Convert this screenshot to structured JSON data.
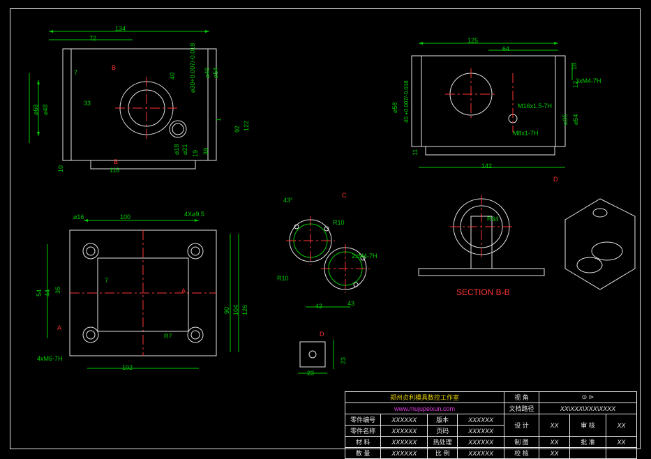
{
  "dims": {
    "d134": "134",
    "d72": "72",
    "d7a": "7",
    "d40": "40",
    "dB": "B",
    "d33": "33",
    "d68": "⌀68",
    "d48": "⌀48",
    "d1": "1",
    "d116": "116",
    "d10": "10",
    "d19": "19",
    "d39": "39",
    "d92": "92",
    "d122": "122",
    "d46": "⌀46",
    "d54": "⌀54",
    "d18": "⌀18",
    "d21": "⌀21",
    "d125": "125",
    "d64": "64",
    "d18a": "18",
    "d12": "12",
    "d3m4": "3xM4-7H",
    "d58": "⌀58",
    "dtol": "40 +0.007/-0.018",
    "dm16": "M16x1.5-7H",
    "dm8": "M8x1-7H",
    "d35": "⌀35",
    "d54b": "⌀54",
    "d11": "11",
    "d142": "142",
    "dD": "D",
    "d35b": "⌀35",
    "d16": "⌀16",
    "d100": "100",
    "d4x95": "4X⌀9.5",
    "d44": "44",
    "d54c": "54",
    "d35c": "35",
    "d7b": "7",
    "dA": "A",
    "d90": "90",
    "d104": "104",
    "d126": "126",
    "dr7": "R7",
    "d102": "102",
    "d4m6": "4xM6-7H",
    "d43": "43°",
    "dC": "C",
    "dr10": "R10",
    "d2m4": "2xM4-7H",
    "dr10b": "R10",
    "d42": "42",
    "d43b": "43",
    "dD2": "D",
    "d23": "23",
    "d23b": "23",
    "dr34": "R34",
    "secbb": "SECTION B-B",
    "d30007": "⌀30+0.007/-0.018"
  },
  "title": {
    "company": "郑州贞利模具数控工作室",
    "url": "www.mujupeixun.com",
    "r1c1": "零件编号",
    "r1c2": "XXXXXX",
    "r1c3": "版本",
    "r1c4": "XXXXXX",
    "r2c1": "零件名称",
    "r2c2": "XXXXXX",
    "r2c3": "页码",
    "r2c4": "XXXXXX",
    "r3c1": "材 料",
    "r3c2": "XXXXXX",
    "r3c3": "热处理",
    "r3c4": "XXXXXX",
    "r4c1": "数 量",
    "r4c2": "XXXXXX",
    "r4c3": "比 例",
    "r4c4": "XXXXXX",
    "h1": "视  角",
    "h2": "文档路径",
    "path": "XX\\XXX\\XXX\\XXXX",
    "a1": "设   计",
    "a2": "XX",
    "a3": "审  核",
    "a4": "XX",
    "b1": "制  图",
    "b2": "XX",
    "b3": "批  准",
    "b4": "XX",
    "c1": "校  核",
    "c2": "XX",
    "c3": "",
    "c4": ""
  }
}
